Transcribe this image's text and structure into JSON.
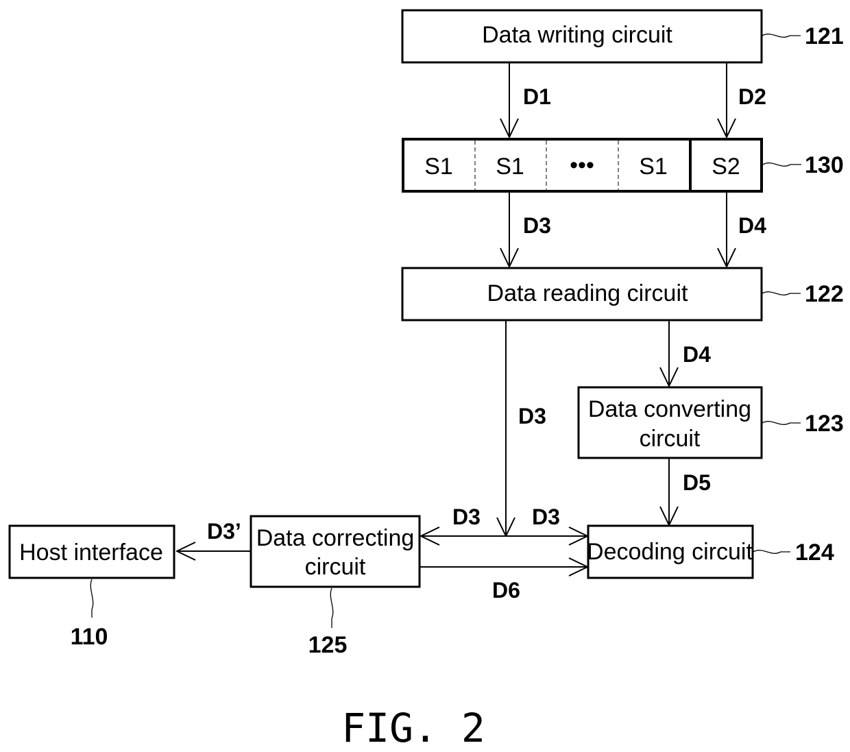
{
  "figure": {
    "caption": "FIG. 2"
  },
  "blocks": {
    "data_writing": {
      "label": "Data writing circuit",
      "ref": "121"
    },
    "memory": {
      "cells": [
        "S1",
        "S1",
        "•••",
        "S1",
        "S2"
      ],
      "ref": "130"
    },
    "data_reading": {
      "label": "Data reading circuit",
      "ref": "122"
    },
    "data_converting": {
      "label_line1": "Data converting",
      "label_line2": "circuit",
      "ref": "123"
    },
    "decoding": {
      "label": "Decoding circuit",
      "ref": "124"
    },
    "data_correcting": {
      "label_line1": "Data correcting",
      "label_line2": "circuit",
      "ref": "125"
    },
    "host_interface": {
      "label": "Host interface",
      "ref": "110"
    }
  },
  "signals": {
    "write_to_s1": "D1",
    "write_to_s2": "D2",
    "s1_to_read": "D3",
    "s2_to_read": "D4",
    "read_to_convert": "D4",
    "read_down": "D3",
    "convert_to_decode": "D5",
    "to_correcting": "D3",
    "to_decoding": "D3",
    "correct_decode_bidir": "D6",
    "correct_to_host": "D3’"
  }
}
